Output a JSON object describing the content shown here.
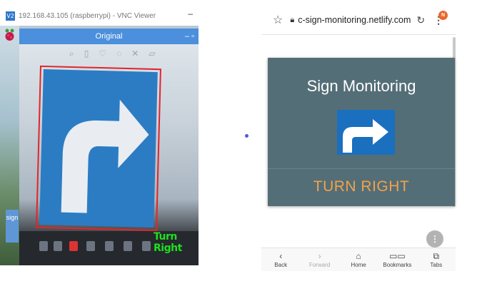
{
  "vnc": {
    "logo_text": "V2",
    "title": "192.168.43.105 (raspberrypi) - VNC Viewer",
    "minimize": "–"
  },
  "desktop": {
    "side_label": "sign"
  },
  "original_window": {
    "title": "Original",
    "controls": "– ▫",
    "detection_label": "Turn Right",
    "box_color": "#e3242b",
    "label_color": "#1ee01e"
  },
  "browser": {
    "url": "c-sign-monitoring.netlify.com",
    "notification_badge": "N",
    "nav": [
      {
        "label": "Back",
        "icon": "chevron-left-icon",
        "enabled": true
      },
      {
        "label": "Forward",
        "icon": "chevron-right-icon",
        "enabled": false
      },
      {
        "label": "Home",
        "icon": "home-icon",
        "enabled": true
      },
      {
        "label": "Bookmarks",
        "icon": "bookmarks-icon",
        "enabled": true
      },
      {
        "label": "Tabs",
        "icon": "tabs-icon",
        "enabled": true
      }
    ]
  },
  "card": {
    "title": "Sign Monitoring",
    "result": "TURN RIGHT",
    "background": "#546e77",
    "result_color": "#f2a24a",
    "sign_color": "#1a6fbf"
  }
}
